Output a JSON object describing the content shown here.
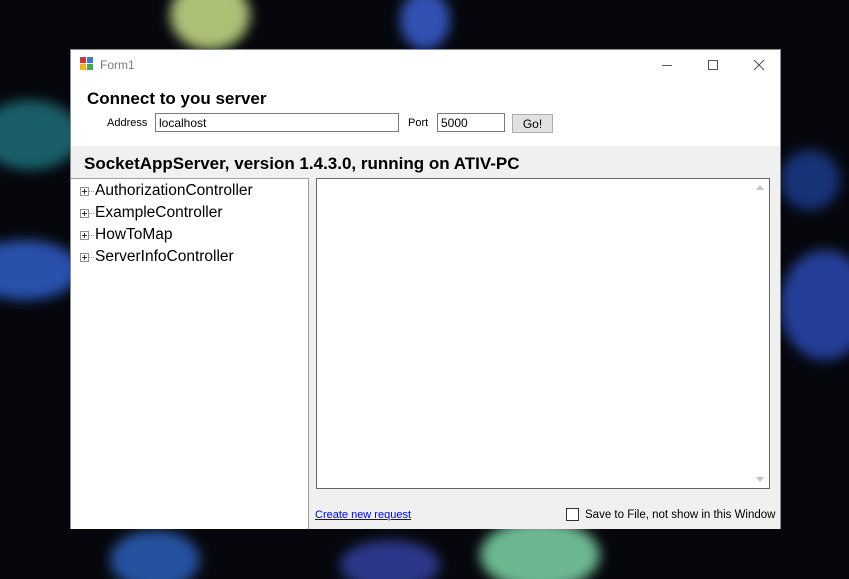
{
  "window": {
    "title": "Form1",
    "icons": {
      "app": "app-form-icon",
      "minimize": "minimize-icon",
      "maximize": "maximize-icon",
      "close": "close-icon"
    }
  },
  "connect": {
    "heading": "Connect to you server",
    "address_label": "Address",
    "address_value": "localhost",
    "port_label": "Port",
    "port_value": "5000",
    "go_label": "Go!"
  },
  "server": {
    "status_text": "SocketAppServer, version 1.4.3.0, running on ATIV-PC"
  },
  "tree": {
    "items": [
      {
        "label": "AuthorizationController"
      },
      {
        "label": "ExampleController"
      },
      {
        "label": "HowToMap"
      },
      {
        "label": "ServerInfoController"
      }
    ]
  },
  "output": {
    "content": ""
  },
  "footer": {
    "link_label": "Create new request",
    "checkbox_label": "Save to File, not show in this Window",
    "checkbox_checked": false
  }
}
